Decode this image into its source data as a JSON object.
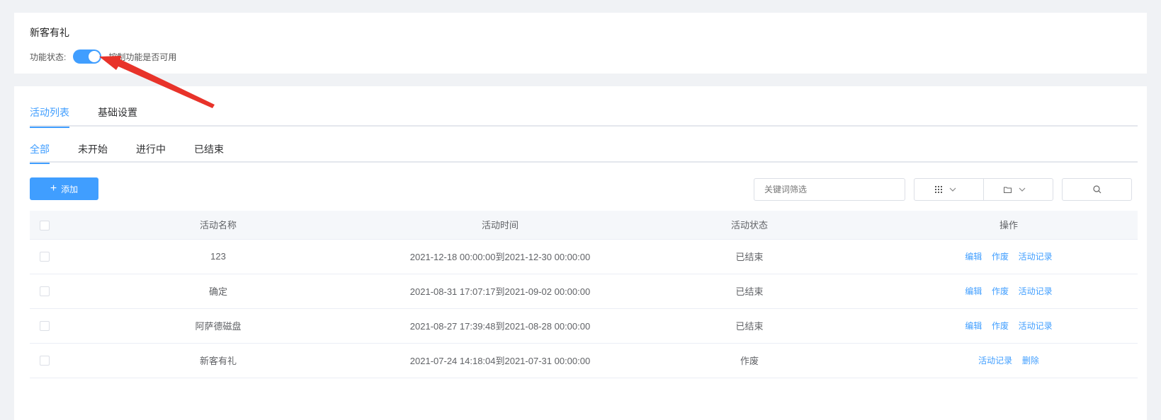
{
  "feature": {
    "title": "新客有礼",
    "status_label": "功能状态:",
    "switch_on": true,
    "status_desc": "控制功能是否可用"
  },
  "tabs": [
    {
      "label": "活动列表",
      "active": true
    },
    {
      "label": "基础设置",
      "active": false
    }
  ],
  "subtabs": [
    {
      "label": "全部",
      "active": true
    },
    {
      "label": "未开始",
      "active": false
    },
    {
      "label": "进行中",
      "active": false
    },
    {
      "label": "已结束",
      "active": false
    }
  ],
  "toolbar": {
    "add_label": "添加",
    "search_placeholder": "关键词筛选",
    "grid_icon": "grid-icon",
    "folder_icon": "folder-icon",
    "search_icon": "search-icon"
  },
  "table": {
    "headers": [
      "活动名称",
      "活动时间",
      "活动状态",
      "操作"
    ],
    "rows": [
      {
        "name": "123",
        "time": "2021-12-18 00:00:00到2021-12-30 00:00:00",
        "status": "已结束",
        "actions": [
          "编辑",
          "作废",
          "活动记录"
        ]
      },
      {
        "name": "确定",
        "time": "2021-08-31 17:07:17到2021-09-02 00:00:00",
        "status": "已结束",
        "actions": [
          "编辑",
          "作废",
          "活动记录"
        ]
      },
      {
        "name": "阿萨德磁盘",
        "time": "2021-08-27 17:39:48到2021-08-28 00:00:00",
        "status": "已结束",
        "actions": [
          "编辑",
          "作废",
          "活动记录"
        ]
      },
      {
        "name": "新客有礼",
        "time": "2021-07-24 14:18:04到2021-07-31 00:00:00",
        "status": "作废",
        "actions": [
          "活动记录",
          "删除"
        ]
      }
    ]
  },
  "colors": {
    "accent": "#409eff",
    "annotation": "#e8332a"
  }
}
